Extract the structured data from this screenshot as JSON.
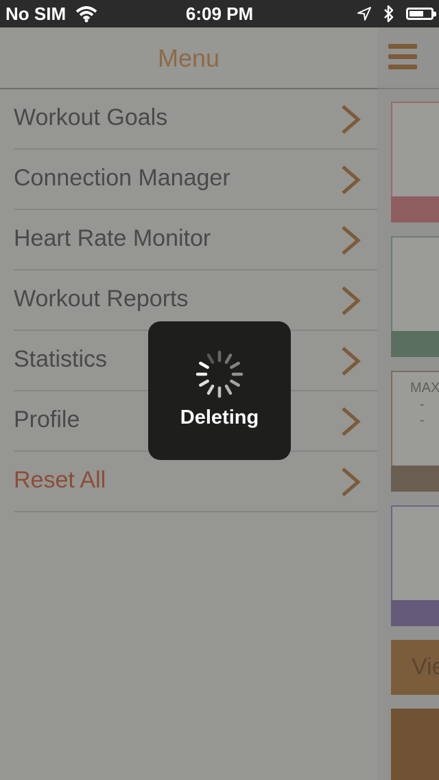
{
  "status_bar": {
    "carrier": "No SIM",
    "time": "6:09 PM",
    "battery_level": 0.65
  },
  "menu": {
    "title": "Menu",
    "items": [
      {
        "label": "Workout Goals"
      },
      {
        "label": "Connection Manager"
      },
      {
        "label": "Heart Rate Monitor"
      },
      {
        "label": "Workout Reports"
      },
      {
        "label": "Statistics"
      },
      {
        "label": "Profile"
      },
      {
        "label": "Reset All"
      }
    ]
  },
  "dashboard_peek": {
    "max_label": "MAX",
    "max_value": "- -",
    "view_button_label": "View"
  },
  "loading": {
    "label": "Deleting"
  },
  "colors": {
    "accent": "#c8894d",
    "reset_all": "#c0604a",
    "card_red": "#c07478",
    "card_green": "#6a8a72",
    "card_brown": "#7e6e5a",
    "card_purple": "#7a6a94"
  },
  "icons": {
    "menu": "hamburger-icon",
    "chevron": "chevron-right-icon",
    "spinner": "activity-spinner-icon",
    "wifi": "wifi-icon",
    "location": "location-arrow-icon",
    "bluetooth": "bluetooth-icon",
    "battery": "battery-icon"
  }
}
